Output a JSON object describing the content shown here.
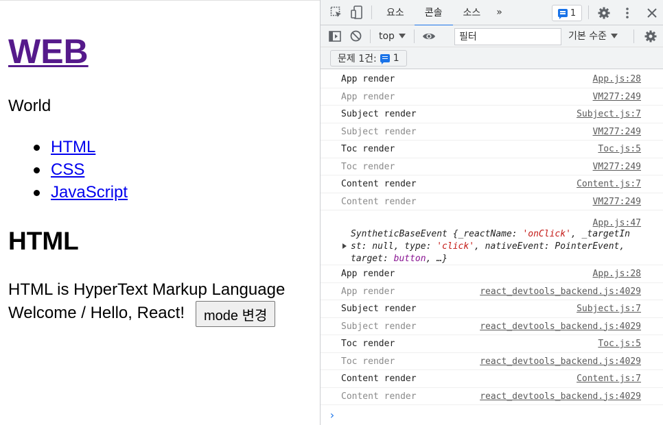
{
  "page": {
    "site_title": "WEB",
    "subtitle": "World",
    "nav": [
      "HTML",
      "CSS",
      "JavaScript"
    ],
    "article_title": "HTML",
    "article_desc": "HTML is HyperText Markup Language",
    "welcome_text": "Welcome / Hello, React!",
    "mode_button": "mode 변경"
  },
  "devtools": {
    "tabs": [
      "요소",
      "콘솔",
      "소스"
    ],
    "active_tab": "콘솔",
    "more_tabs": "»",
    "issue_badge_count": "1",
    "context": "top",
    "filter_placeholder": "필터",
    "level": "기본 수준",
    "issues_label": "문제 1건:",
    "issues_count": "1",
    "prompt": "›",
    "icons": {
      "inspect": "inspect-element-icon",
      "device": "device-toggle-icon",
      "settings": "gear-icon",
      "more": "kebab-menu-icon",
      "close": "close-icon",
      "sidebar": "sidebar-toggle-icon",
      "clear": "clear-console-icon",
      "eye": "live-expression-eye-icon"
    }
  },
  "console": {
    "rows": [
      {
        "msg": "App render",
        "src": "App.js:28",
        "faded": false
      },
      {
        "msg": "App render",
        "src": "VM277:249",
        "faded": true
      },
      {
        "msg": "Subject render",
        "src": "Subject.js:7",
        "faded": false
      },
      {
        "msg": "Subject render",
        "src": "VM277:249",
        "faded": true
      },
      {
        "msg": "Toc render",
        "src": "Toc.js:5",
        "faded": false
      },
      {
        "msg": "Toc render",
        "src": "VM277:249",
        "faded": true
      },
      {
        "msg": "Content render",
        "src": "Content.js:7",
        "faded": false
      },
      {
        "msg": "Content render",
        "src": "VM277:249",
        "faded": true
      }
    ],
    "event_log": {
      "src": "App.js:47",
      "line1_a": "SyntheticBaseEvent {_reactName: ",
      "line1_b": "'onClick'",
      "line1_c": ", _targetIn",
      "line2_a": "st: null, type: ",
      "line2_b": "'click'",
      "line2_c": ", nativeEvent: PointerEvent,",
      "line3_a": "target: ",
      "line3_b": "button",
      "line3_c": ", …}"
    },
    "rows_after": [
      {
        "msg": "App render",
        "src": "App.js:28",
        "faded": false
      },
      {
        "msg": "App render",
        "src": "react_devtools_backend.js:4029",
        "faded": true
      },
      {
        "msg": "Subject render",
        "src": "Subject.js:7",
        "faded": false
      },
      {
        "msg": "Subject render",
        "src": "react_devtools_backend.js:4029",
        "faded": true
      },
      {
        "msg": "Toc render",
        "src": "Toc.js:5",
        "faded": false
      },
      {
        "msg": "Toc render",
        "src": "react_devtools_backend.js:4029",
        "faded": true
      },
      {
        "msg": "Content render",
        "src": "Content.js:7",
        "faded": false
      },
      {
        "msg": "Content render",
        "src": "react_devtools_backend.js:4029",
        "faded": true
      }
    ]
  }
}
